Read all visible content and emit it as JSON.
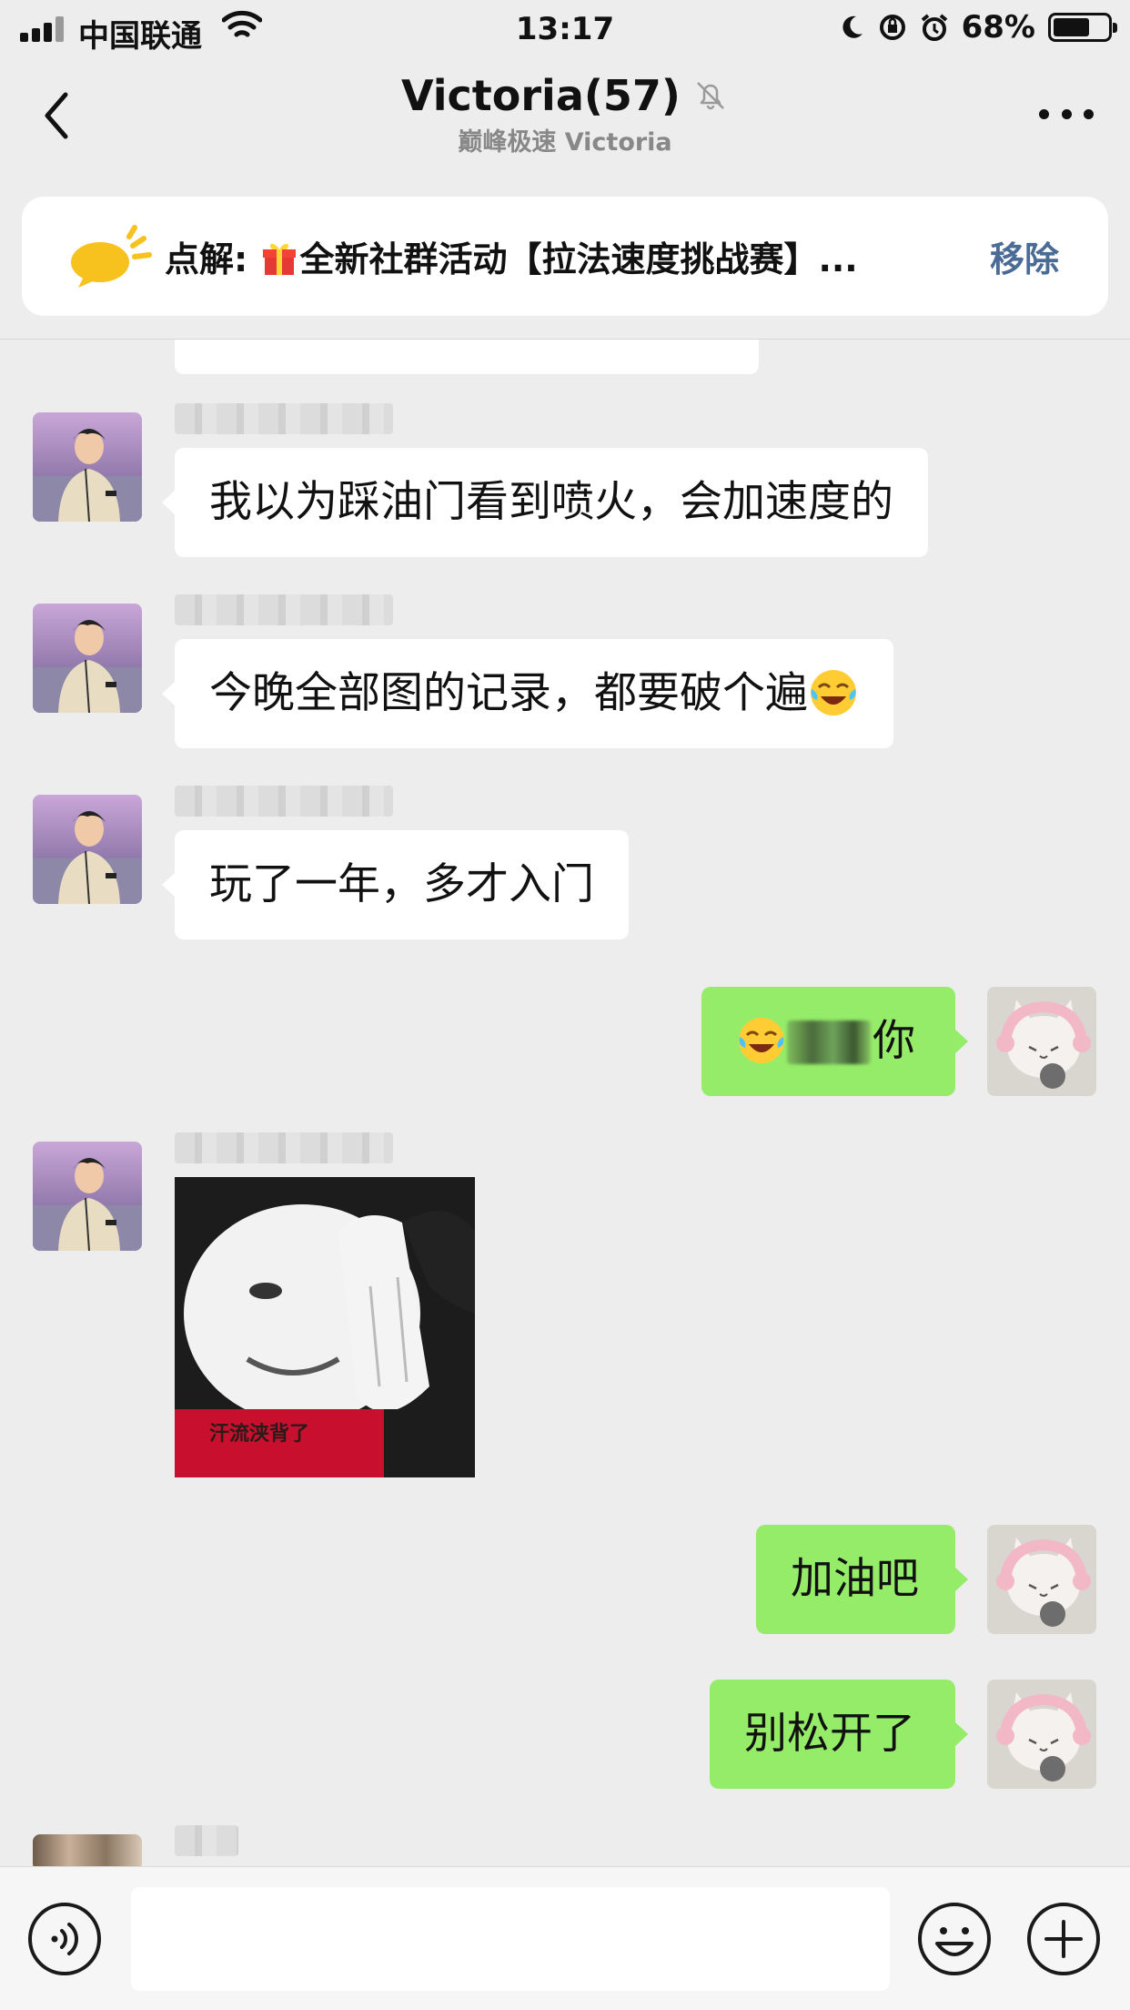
{
  "status_bar": {
    "carrier": "中国联通",
    "time": "13:17",
    "battery_percent": "68%",
    "battery_level": 0.68
  },
  "nav": {
    "title": "Victoria(57)",
    "subtitle": "巅峰极速 Victoria",
    "back_icon": "chevron-left-icon",
    "mute_icon": "bell-muted-icon",
    "more_icon": "more-dots-icon"
  },
  "pinned": {
    "prefix": "点解: ",
    "gift_icon": "gift-icon",
    "text": "全新社群活动【拉法速度挑战赛】...",
    "remove_label": "移除"
  },
  "messages": [
    {
      "side": "left",
      "text": "我以为踩油门看到喷火，会加速度的"
    },
    {
      "side": "left",
      "text": "今晚全部图的记录，都要破个遍",
      "emoji": "laugh-cry-emoji"
    },
    {
      "side": "left",
      "text": "玩了一年，多才入门"
    },
    {
      "side": "right",
      "emoji": "laugh-cry-emoji",
      "text": "你"
    },
    {
      "side": "left",
      "type": "sticker",
      "caption": "汗流浃背了"
    },
    {
      "side": "right",
      "text": "加油吧"
    },
    {
      "side": "right",
      "text": "别松开了"
    }
  ],
  "input_bar": {
    "voice_icon": "voice-icon",
    "emoji_icon": "smiley-icon",
    "plus_icon": "plus-circle-icon",
    "value": ""
  },
  "colors": {
    "background": "#ededed",
    "bubble_self": "#95ec69",
    "bubble_other": "#ffffff",
    "link_blue": "#4a6b96"
  }
}
